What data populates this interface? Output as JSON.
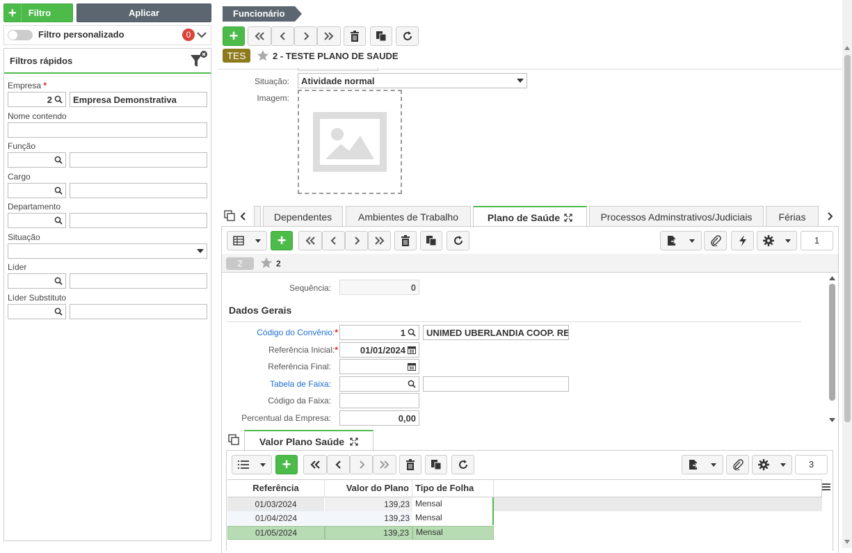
{
  "left": {
    "filtro_label": "Filtro",
    "aplicar_label": "Aplicar",
    "filtro_personalizado": "Filtro personalizado",
    "filter_count": "0",
    "filtros_rapidos": "Filtros rápidos",
    "empresa_label": "Empresa",
    "empresa_code": "2",
    "empresa_name": "Empresa Demonstrativa",
    "nome_label": "Nome contendo",
    "funcao_label": "Função",
    "cargo_label": "Cargo",
    "departamento_label": "Departamento",
    "situacao_label": "Situação",
    "lider_label": "Líder",
    "lider_sub_label": "Líder Substituto"
  },
  "header": {
    "breadcrumb": "Funcionário",
    "badge": "TES",
    "title": "2 - TESTE PLANO DE SAUDE"
  },
  "form": {
    "situacao_label": "Situação:",
    "situacao_value": "Atividade normal",
    "imagem_label": "Imagem:"
  },
  "tabs": [
    "Dependentes",
    "Ambientes de Trabalho",
    "Plano de Saúde",
    "Processos Adminstrativos/Judiciais",
    "Férias"
  ],
  "plano": {
    "page_num": "1",
    "record_badge": "2",
    "record_title": "2",
    "sequencia_label": "Sequência:",
    "sequencia_value": "0",
    "dados_gerais": "Dados Gerais",
    "codigo_convenio_label": "Código do Convênio:",
    "codigo_convenio_value": "1",
    "convenio_name": "UNIMED UBERLANDIA COOP. RE",
    "ref_inicial_label": "Referência Inicial:",
    "ref_inicial_value": "01/01/2024",
    "ref_final_label": "Referência Final:",
    "tabela_faixa_label": "Tabela de Faixa:",
    "codigo_faixa_label": "Código da Faixa:",
    "percentual_label": "Percentual da Empresa:",
    "percentual_value": "0,00"
  },
  "valor": {
    "tab_label": "Valor Plano Saúde",
    "page_num": "3",
    "columns": [
      "Referência",
      "Valor do Plano",
      "Tipo de Folha"
    ],
    "rows": [
      {
        "ref": "01/03/2024",
        "valor": "139,23",
        "tipo": "Mensal"
      },
      {
        "ref": "01/04/2024",
        "valor": "139,23",
        "tipo": "Mensal"
      },
      {
        "ref": "01/05/2024",
        "valor": "139,23",
        "tipo": "Mensal"
      }
    ]
  },
  "colors": {
    "accent": "#4cbb4a",
    "badge": "#8d7a1c",
    "link": "#1f6fd1",
    "selected_row": "#b7dbb3"
  }
}
